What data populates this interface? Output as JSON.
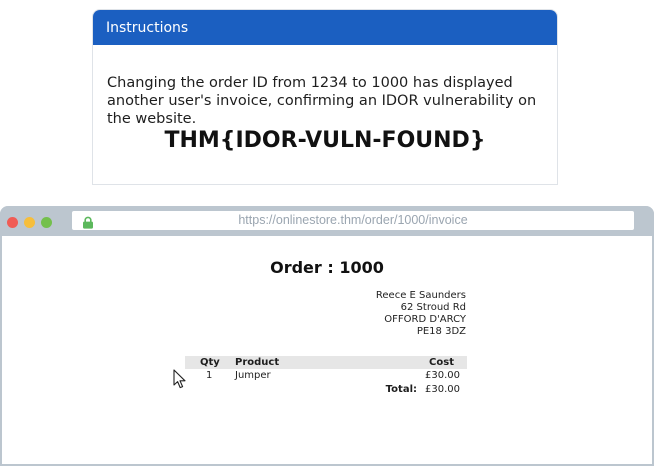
{
  "instructions": {
    "header": "Instructions",
    "text": "Changing the order ID from 1234 to 1000 has displayed another user's invoice, confirming an IDOR vulnerability on the website.",
    "flag": "THM{IDOR-VULN-FOUND}"
  },
  "browser": {
    "url": "https://onlinestore.thm/order/1000/invoice",
    "window_controls": [
      "close",
      "minimize",
      "maximize"
    ],
    "icons": {
      "lock": "lock-icon"
    },
    "colors": {
      "close": "#f05c55",
      "minimize": "#f6be3b",
      "maximize": "#74c04c",
      "lock": "#5cb85c"
    }
  },
  "invoice": {
    "title": "Order : 1000",
    "address": [
      "Reece E Saunders",
      "62 Stroud Rd",
      "OFFORD D'ARCY",
      "PE18 3DZ"
    ],
    "columns": {
      "qty": "Qty",
      "product": "Product",
      "cost": "Cost"
    },
    "items": [
      {
        "qty": "1",
        "product": "Jumper",
        "cost": "£30.00"
      }
    ],
    "total_label": "Total:",
    "total_value": "£30.00"
  },
  "colors": {
    "header_bg": "#1b5fc1",
    "browser_chrome": "#bcc6cf"
  }
}
